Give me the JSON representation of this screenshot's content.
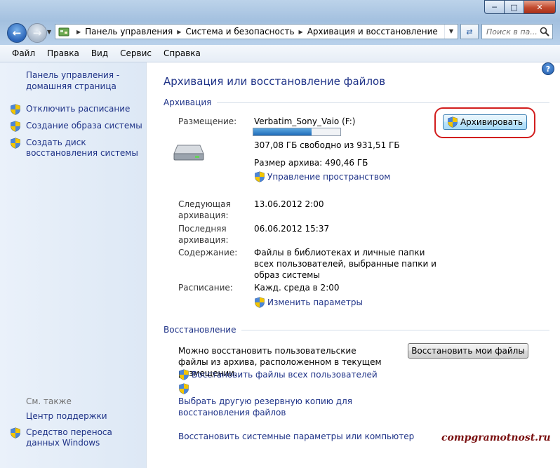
{
  "window": {
    "caption_buttons": {
      "minimize": "─",
      "maximize": "□",
      "close": "✕"
    }
  },
  "nav": {
    "breadcrumb": [
      "Панель управления",
      "Система и безопасность",
      "Архивация и восстановление"
    ],
    "search_placeholder": "Поиск в па...",
    "icons": [
      "back-arrow-icon",
      "forward-arrow-icon",
      "control-panel-icon",
      "refresh-icon",
      "search-icon"
    ]
  },
  "menu": [
    "Файл",
    "Правка",
    "Вид",
    "Сервис",
    "Справка"
  ],
  "help_label": "?",
  "left_pane": {
    "home_link": "Панель управления - домашняя страница",
    "tasks": [
      {
        "label": "Отключить расписание",
        "icon": "uac-shield-icon"
      },
      {
        "label": "Создание образа системы",
        "icon": "uac-shield-icon"
      },
      {
        "label": "Создать диск восстановления системы",
        "icon": "uac-shield-icon"
      }
    ],
    "see_also_header": "См. также",
    "see_also": [
      {
        "label": "Центр поддержки"
      },
      {
        "label": "Средство переноса данных Windows",
        "icon": "uac-shield-icon"
      }
    ]
  },
  "main": {
    "title": "Архивация или восстановление файлов",
    "backup": {
      "header": "Архивация",
      "location_label": "Размещение:",
      "location_value": "Verbatim_Sony_Vaio (F:)",
      "free_space": "307,08 ГБ свободно из 931,51 ГБ",
      "used_fraction": 0.67,
      "archive_size": "Размер архива: 490,46 ГБ",
      "manage_space_link": "Управление пространством",
      "backup_button": "Архивировать",
      "next_label": "Следующая архивация:",
      "next_value": "13.06.2012 2:00",
      "last_label": "Последняя архивация:",
      "last_value": "06.06.2012 15:37",
      "contents_label": "Содержание:",
      "contents_value": "Файлы в библиотеках и личные папки всех пользователей, выбранные папки и образ системы",
      "schedule_label": "Расписание:",
      "schedule_value": "Кажд. среда в 2:00",
      "change_settings_link": "Изменить параметры",
      "drive_icon": "hard-drive-icon"
    },
    "restore": {
      "header": "Восстановление",
      "description": "Можно восстановить пользовательские файлы из архива, расположенном в текущем размещении.",
      "restore_button": "Восстановить мои файлы",
      "all_users_link": "Восстановить файлы всех пользователей",
      "other_backup_link": "Выбрать другую резервную копию для восстановления файлов",
      "system_link": "Восстановить системные параметры или компьютер"
    }
  },
  "watermark": "compgramotnost.ru",
  "colors": {
    "link": "#1e3287",
    "highlight_ring": "#d21e1e",
    "progress": "#1f6bb8"
  }
}
